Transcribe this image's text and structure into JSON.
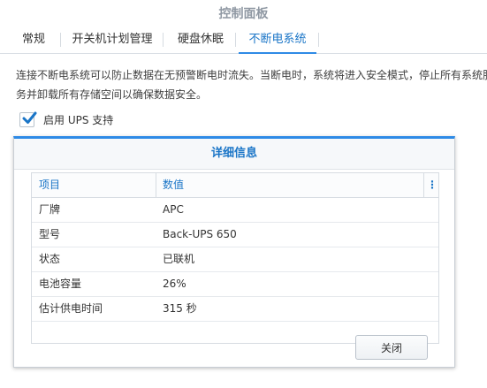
{
  "window": {
    "title": "控制面板"
  },
  "tabs": [
    {
      "label": "常规"
    },
    {
      "label": "开关机计划管理"
    },
    {
      "label": "硬盘休眠"
    },
    {
      "label": "不断电系统"
    }
  ],
  "description": "连接不断电系统可以防止数据在无预警断电时流失。当断电时，系统将进入安全模式，停止所有系统服务并卸载所有存储空间以确保数据安全。",
  "ups": {
    "enable_label": "启用 UPS 支持",
    "enabled": true
  },
  "dialog": {
    "title": "详细信息",
    "columns": {
      "item": "项目",
      "value": "数值"
    },
    "rows": [
      {
        "item": "厂牌",
        "value": "APC"
      },
      {
        "item": "型号",
        "value": "Back-UPS 650"
      },
      {
        "item": "状态",
        "value": "已联机"
      },
      {
        "item": "电池容量",
        "value": "26%"
      },
      {
        "item": "估计供电时间",
        "value": "315 秒"
      }
    ],
    "close_label": "关闭"
  },
  "colors": {
    "accent": "#2e8ae6",
    "accent_text": "#1a75c7"
  }
}
